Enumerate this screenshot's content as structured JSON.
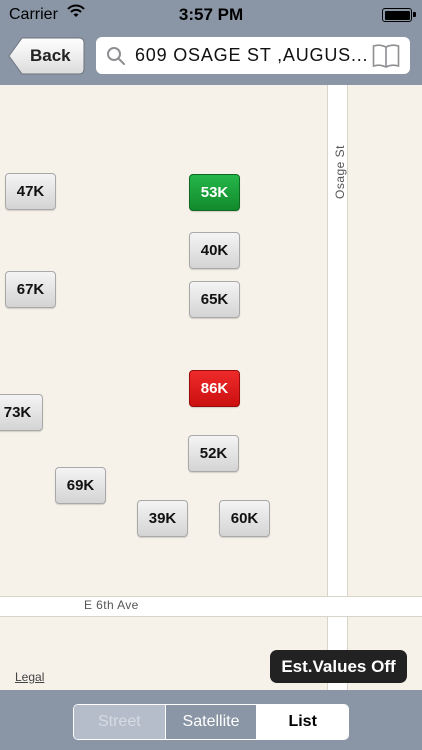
{
  "status_bar": {
    "carrier": "Carrier",
    "time": "3:57 PM"
  },
  "nav": {
    "back_label": "Back",
    "search_value": "609  OSAGE ST ,AUGUS..."
  },
  "map": {
    "streets": {
      "vertical": "Osage St",
      "horizontal": "E 6th Ave"
    },
    "legal": "Legal",
    "markers": [
      {
        "label": "47K",
        "status": "normal"
      },
      {
        "label": "53K",
        "status": "green"
      },
      {
        "label": "40K",
        "status": "normal"
      },
      {
        "label": "67K",
        "status": "normal"
      },
      {
        "label": "65K",
        "status": "normal"
      },
      {
        "label": "86K",
        "status": "red"
      },
      {
        "label": "73K",
        "status": "normal"
      },
      {
        "label": "52K",
        "status": "normal"
      },
      {
        "label": "69K",
        "status": "normal"
      },
      {
        "label": "39K",
        "status": "normal"
      },
      {
        "label": "60K",
        "status": "normal"
      }
    ],
    "est_values_toggle": "Est.Values Off"
  },
  "bottom_bar": {
    "segments": [
      {
        "label": "Street",
        "state": "disabled"
      },
      {
        "label": "Satellite",
        "state": "normal"
      },
      {
        "label": "List",
        "state": "selected"
      }
    ]
  },
  "colors": {
    "bar": "#8a96a5",
    "map_bg": "#f6f2ea",
    "marker_green": "#1fa03e",
    "marker_red": "#e01c1c"
  }
}
